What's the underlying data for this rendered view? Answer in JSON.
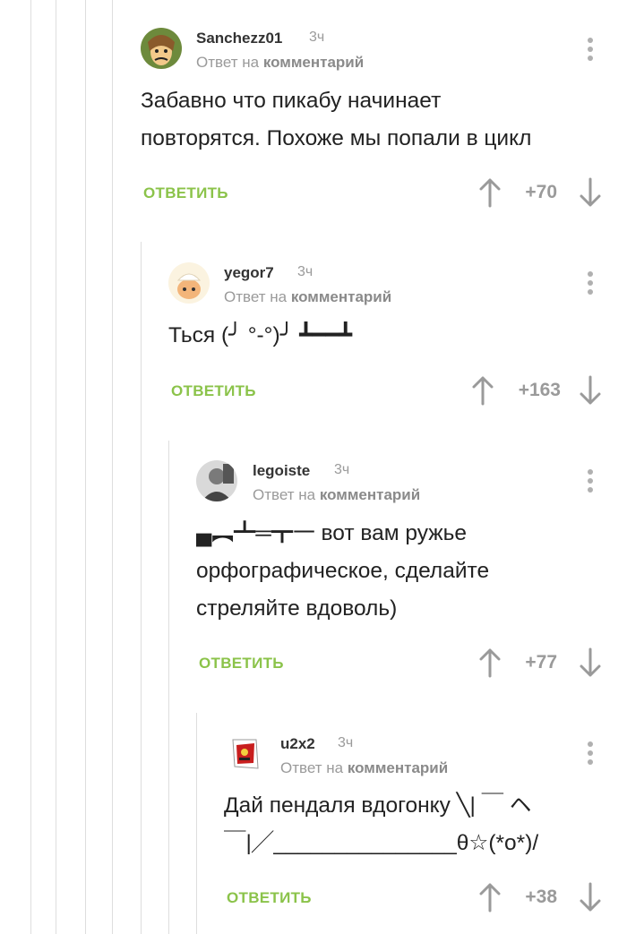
{
  "comments": [
    {
      "username": "Sanchezz01",
      "time": "3ч",
      "reply_prefix": "Ответ на",
      "reply_link": "комментарий",
      "text": "Забавно что пикабу начинает\nповторятся. Похоже мы попали в цикл",
      "reply_label": "ОТВЕТИТЬ",
      "rating": "+70"
    },
    {
      "username": "yegor7",
      "time": "3ч",
      "reply_prefix": "Ответ на",
      "reply_link": "комментарий",
      "text": "Ться (╯ °-°)╯ ┻━━┻",
      "reply_label": "ОТВЕТИТЬ",
      "rating": "+163"
    },
    {
      "username": "legoiste",
      "time": "3ч",
      "reply_prefix": "Ответ на",
      "reply_link": "комментарий",
      "text": "▄︻┻═┳一 вот вам ружье\nорфографическое, сделайте\nстреляйте вдоволь)",
      "reply_label": "ОТВЕТИТЬ",
      "rating": "+77"
    },
    {
      "username": "u2x2",
      "time": "3ч",
      "reply_prefix": "Ответ на",
      "reply_link": "комментарий",
      "text": "Дай пендаля вдогонку ╲| ￣ ヘ\n￣|╱_______________θ☆(*o*)/",
      "reply_label": "ОТВЕТИТЬ",
      "rating": "+38"
    }
  ],
  "colors": {
    "accent": "#8bc34a",
    "muted": "#9a9a9a",
    "thread_line": "#dedede"
  },
  "icons": [
    "menu-dots-icon",
    "arrow-up-icon",
    "arrow-down-icon",
    "avatar"
  ]
}
